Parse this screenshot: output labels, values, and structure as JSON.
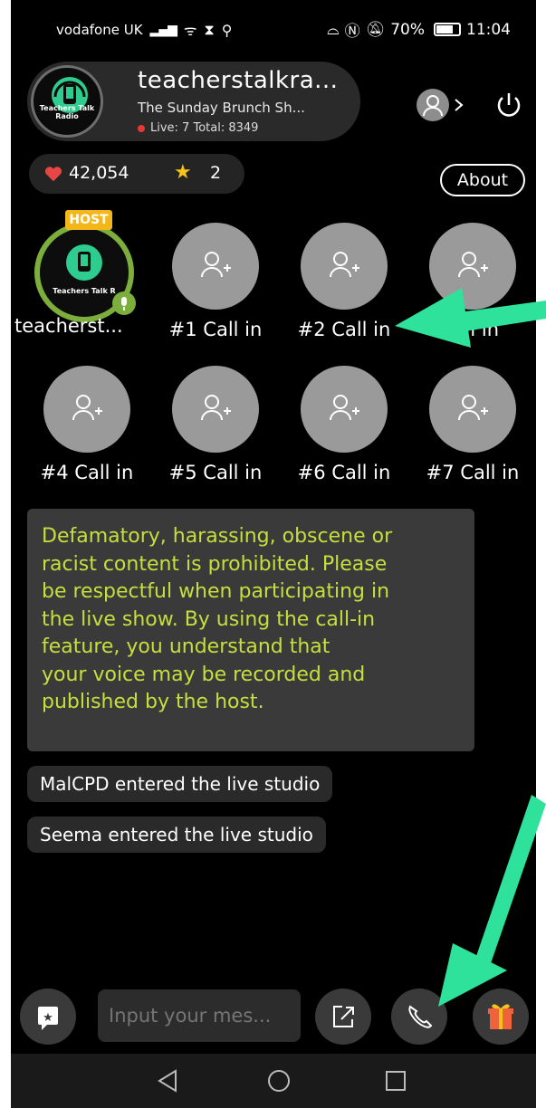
{
  "status_bar": {
    "carrier": "vodafone UK",
    "signal": "📶",
    "battery_percent": "70%",
    "time": "11:04"
  },
  "header": {
    "logo_text": "Teachers Talk Radio",
    "host_name": "teacherstalkra...",
    "show_name": "The Sunday Brunch Sh...",
    "live_stats": "Live: 7  Total: 8349"
  },
  "stats": {
    "likes": "42,054",
    "stars": "2",
    "about_label": "About"
  },
  "seats": [
    {
      "label": "teacherst...",
      "badge": "HOST"
    },
    {
      "label": "#1 Call in"
    },
    {
      "label": "#2 Call in"
    },
    {
      "label": "Call in"
    },
    {
      "label": "#4 Call in"
    },
    {
      "label": "#5 Call in"
    },
    {
      "label": "#6 Call in"
    },
    {
      "label": "#7 Call in"
    }
  ],
  "notice": {
    "lines": [
      "Defamatory, harassing, obscene or",
      "racist content is prohibited. Please",
      "be respectful when participating in",
      "the live show. By using the call-in",
      "feature, you understand that",
      "your voice may be recorded and",
      "published by the host."
    ]
  },
  "chat": [
    "MalCPD entered the live studio",
    "Seema entered the live studio"
  ],
  "input": {
    "placeholder": "Input your mes..."
  },
  "colors": {
    "arrow": "#2ee29b",
    "notice_text": "#c7df3c",
    "host_ring": "#7cae3c",
    "host_badge": "#f3b71a",
    "gift": "#f0633a"
  }
}
